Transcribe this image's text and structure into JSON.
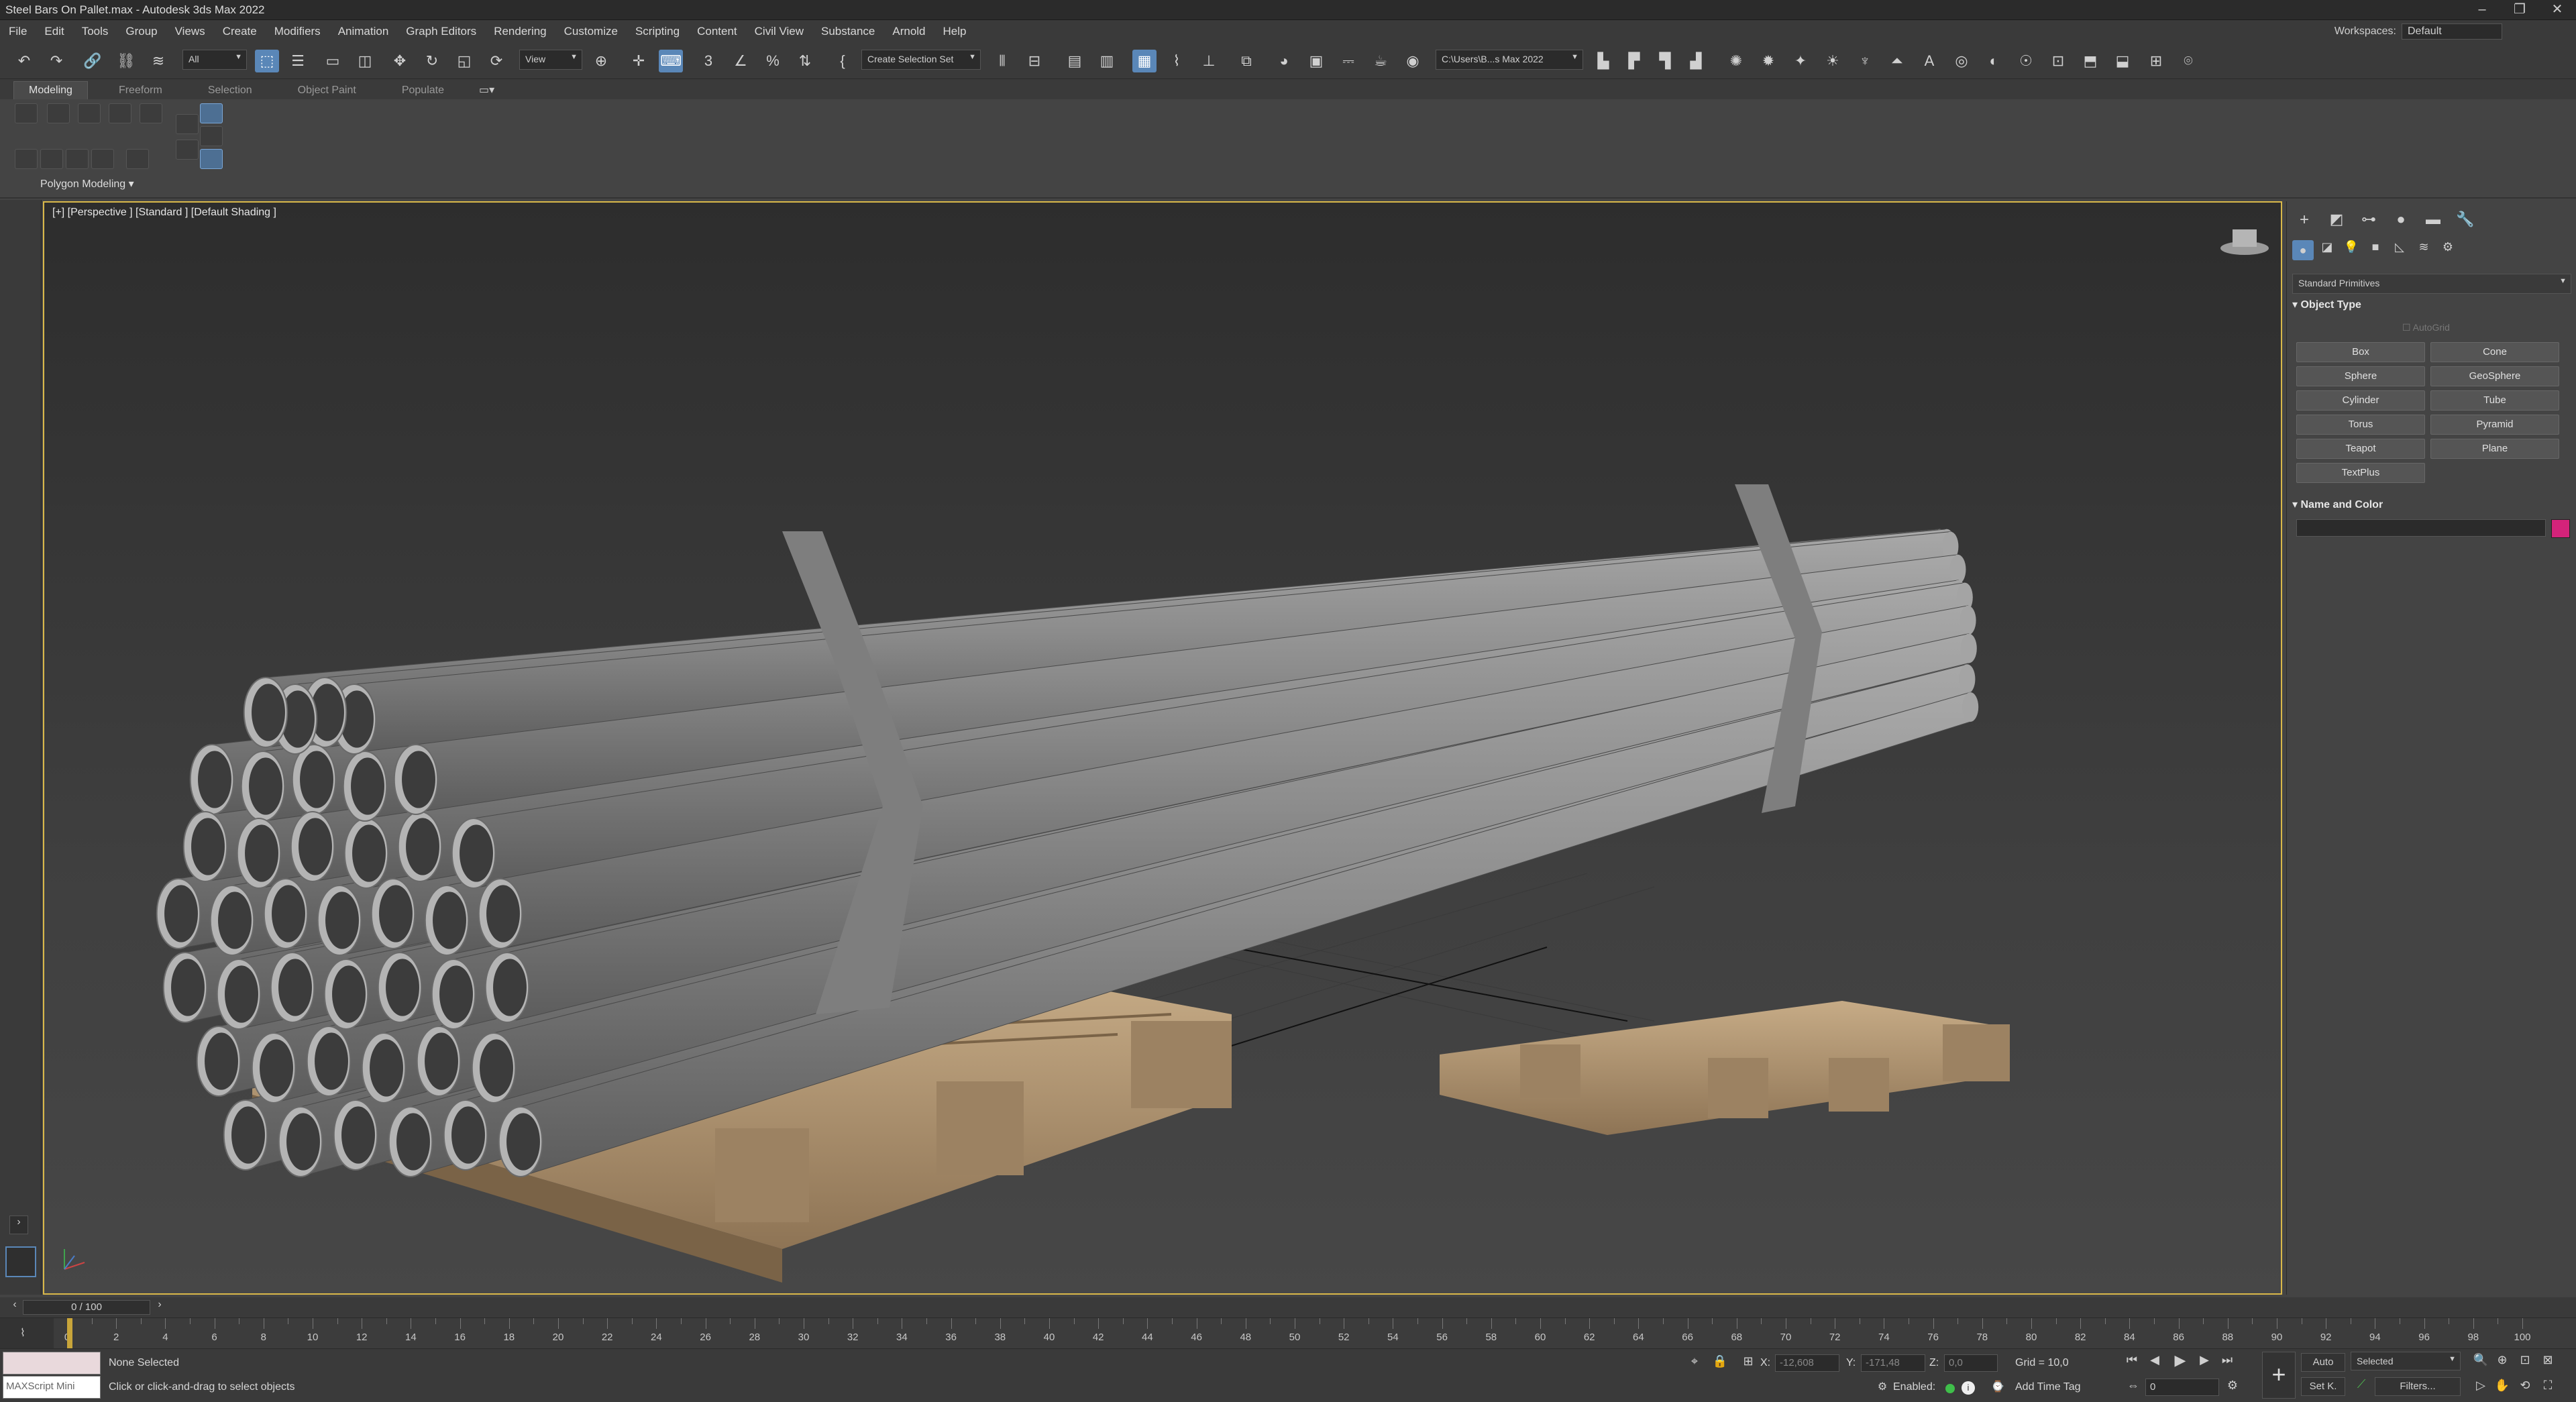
{
  "window": {
    "title": "Steel Bars On Pallet.max - Autodesk 3ds Max 2022"
  },
  "menus": [
    "File",
    "Edit",
    "Tools",
    "Group",
    "Views",
    "Create",
    "Modifiers",
    "Animation",
    "Graph Editors",
    "Rendering",
    "Customize",
    "Scripting",
    "Content",
    "Civil View",
    "Substance",
    "Arnold",
    "Help"
  ],
  "workspaces": {
    "label": "Workspaces:",
    "value": "Default"
  },
  "toolbar": {
    "filter": "All",
    "refcoord": "View",
    "selset": "Create Selection Set",
    "project_path": "C:\\Users\\B...s Max 2022"
  },
  "ribbon": {
    "tabs": [
      "Modeling",
      "Freeform",
      "Selection",
      "Object Paint",
      "Populate"
    ],
    "group_label": "Polygon Modeling"
  },
  "viewport": {
    "label": "[+] [Perspective ] [Standard ] [Default Shading ]"
  },
  "command_panel": {
    "category": "Standard Primitives",
    "object_type_title": "Object Type",
    "autogrid": "AutoGrid",
    "buttons": [
      "Box",
      "Cone",
      "Sphere",
      "GeoSphere",
      "Cylinder",
      "Tube",
      "Torus",
      "Pyramid",
      "Teapot",
      "Plane",
      "TextPlus"
    ],
    "name_color_title": "Name and Color",
    "color": "#d4237a"
  },
  "timeline": {
    "frame": "0 / 100",
    "ticks": [
      "0",
      "2",
      "4",
      "6",
      "8",
      "10",
      "12",
      "14",
      "16",
      "18",
      "20",
      "22",
      "24",
      "26",
      "28",
      "30",
      "32",
      "34",
      "36",
      "38",
      "40",
      "42",
      "44",
      "46",
      "48",
      "50",
      "52",
      "54",
      "56",
      "58",
      "60",
      "62",
      "64",
      "66",
      "68",
      "70",
      "72",
      "74",
      "76",
      "78",
      "80",
      "82",
      "84",
      "86",
      "88",
      "90",
      "92",
      "94",
      "96",
      "98",
      "100"
    ]
  },
  "status": {
    "maxscript": "MAXScript Mini",
    "selection": "None Selected",
    "prompt": "Click or click-and-drag to select objects",
    "x_label": "X:",
    "x_value": "-12,608",
    "y_label": "Y:",
    "y_value": "-171,48",
    "z_label": "Z:",
    "z_value": "0,0",
    "grid": "Grid = 10,0",
    "enabled": "Enabled:",
    "add_time_tag": "Add Time Tag",
    "auto": "Auto",
    "set_k": "Set K.",
    "selected": "Selected",
    "filters": "Filters...",
    "frame_value": "0"
  }
}
